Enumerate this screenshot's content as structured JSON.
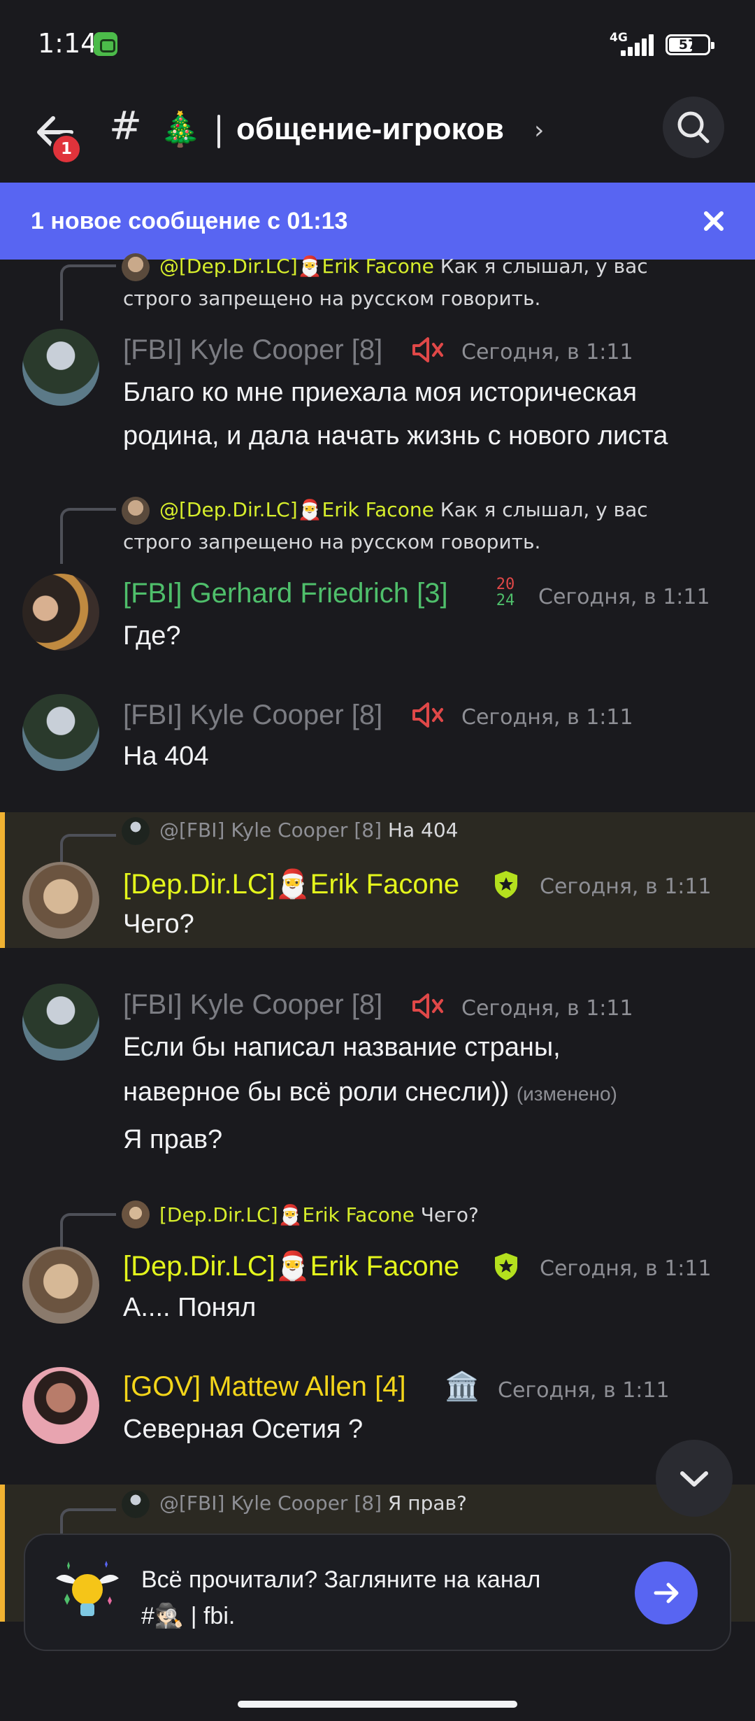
{
  "status_bar": {
    "time": "1:14",
    "network": "4G",
    "battery": "57",
    "battery_level": 0.57
  },
  "header": {
    "back_badge": "1",
    "hash": "#",
    "channel_emoji": "🎄",
    "channel_name": "общение-игроков",
    "chevron": "›"
  },
  "banner": {
    "text": "1 новое сообщение с 01:13",
    "close": "×"
  },
  "messages": [
    {
      "reply_author": "@[Dep.Dir.LC]🎅Erik Facone",
      "reply_text_1": "Как я слышал, у вас",
      "reply_text_2": "строго запрещено на русском говорить."
    },
    {
      "author": "[FBI] Kyle Cooper [8]",
      "timestamp": "Сегодня, в 1:11",
      "lines": [
        "Благо ко мне приехала моя историческая",
        "родина, и дала начать жизнь с нового листа"
      ]
    },
    {
      "reply_author": "@[Dep.Dir.LC]🎅Erik Facone",
      "reply_text_1": "Как я слышал, у вас",
      "reply_text_2": "строго запрещено на русском говорить.",
      "author": "[FBI] Gerhard Friedrich [3]",
      "badge_top": "20",
      "badge_bottom": "24",
      "timestamp": "Сегодня, в 1:11",
      "lines": [
        "Где?"
      ]
    },
    {
      "author": "[FBI] Kyle Cooper [8]",
      "timestamp": "Сегодня, в 1:11",
      "lines": [
        "На 404"
      ]
    },
    {
      "reply_author": "@[FBI] Kyle Cooper [8]",
      "reply_text_1": "На 404",
      "author": "[Dep.Dir.LC]🎅Erik Facone",
      "timestamp": "Сегодня, в 1:11",
      "lines": [
        "Чего?"
      ]
    },
    {
      "author": "[FBI] Kyle Cooper [8]",
      "timestamp": "Сегодня, в 1:11",
      "lines": [
        "Если бы написал название страны,",
        "наверное бы всё роли снесли))",
        "Я прав?"
      ],
      "edited": "(изменено)"
    },
    {
      "reply_author": "[Dep.Dir.LC]🎅Erik Facone",
      "reply_text_1": "Чего?",
      "author": "[Dep.Dir.LC]🎅Erik Facone",
      "timestamp": "Сегодня, в 1:11",
      "lines": [
        "А.... Понял"
      ]
    },
    {
      "author": "[GOV] Mattew Allen [4]",
      "badge_emoji": "🏛️",
      "timestamp": "Сегодня, в 1:11",
      "lines": [
        "Северная Осетия ?"
      ]
    },
    {
      "reply_author": "@[FBI] Kyle Cooper [8]",
      "reply_text_1": "Я прав?"
    }
  ],
  "bottom_card": {
    "line_1": "Всё прочитали? Загляните на канал",
    "line_2": "#🕵🏻 | fbi."
  },
  "icons": {
    "back": "arrow-left-icon",
    "search": "search-icon",
    "mute": "speaker-muted-icon",
    "shield": "shield-star-icon",
    "scroll": "chevron-down-icon",
    "go": "arrow-right-icon",
    "bulb": "winged-lightbulb-icon"
  },
  "colors": {
    "background": "#1a1a1e",
    "accent": "#5865f2",
    "highlight": "#2b2922",
    "highlight_bar": "#f0b232",
    "badge_red": "#e0333b"
  }
}
